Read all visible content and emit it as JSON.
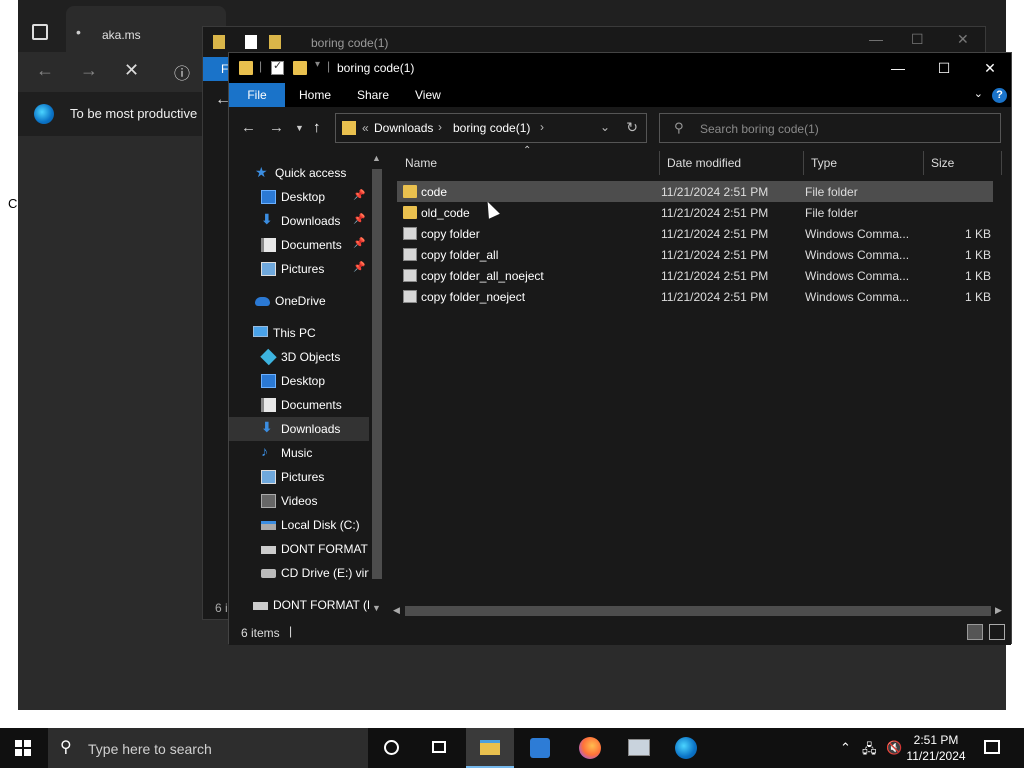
{
  "browser": {
    "tab_title": "aka.ms",
    "info_message": "To be most productive",
    "left_letter": "C"
  },
  "bg_window": {
    "title": "boring code(1)",
    "ribbon_letter": "F",
    "status": "6 i"
  },
  "window": {
    "title": "boring code(1)",
    "ribbon_tabs": [
      "File",
      "Home",
      "Share",
      "View"
    ],
    "address": {
      "overflow": "«",
      "segments": [
        "Downloads",
        "boring code(1)"
      ]
    },
    "search_placeholder": "Search boring code(1)",
    "nav_items": [
      {
        "label": "Quick access",
        "icon": "star-icon",
        "pinned": false
      },
      {
        "label": "Desktop",
        "icon": "desktop-icon",
        "pinned": true
      },
      {
        "label": "Downloads",
        "icon": "download-icon",
        "pinned": true
      },
      {
        "label": "Documents",
        "icon": "documents-icon",
        "pinned": true
      },
      {
        "label": "Pictures",
        "icon": "pictures-icon",
        "pinned": true
      },
      {
        "label": "OneDrive",
        "icon": "cloud-icon",
        "pinned": false
      },
      {
        "label": "This PC",
        "icon": "computer-icon",
        "pinned": false
      },
      {
        "label": "3D Objects",
        "icon": "3d-objects-icon",
        "pinned": false
      },
      {
        "label": "Desktop",
        "icon": "desktop-icon",
        "pinned": false
      },
      {
        "label": "Documents",
        "icon": "documents-icon",
        "pinned": false
      },
      {
        "label": "Downloads",
        "icon": "download-icon",
        "pinned": false,
        "selected": true
      },
      {
        "label": "Music",
        "icon": "music-icon",
        "pinned": false
      },
      {
        "label": "Pictures",
        "icon": "pictures-icon",
        "pinned": false
      },
      {
        "label": "Videos",
        "icon": "videos-icon",
        "pinned": false
      },
      {
        "label": "Local Disk (C:)",
        "icon": "local-disk-icon",
        "pinned": false
      },
      {
        "label": "DONT FORMAT (",
        "icon": "drive-icon",
        "pinned": false
      },
      {
        "label": "CD Drive (E:) virt",
        "icon": "cd-drive-icon",
        "pinned": false
      },
      {
        "label": "DONT FORMAT (D",
        "icon": "drive-icon",
        "pinned": false
      }
    ],
    "columns": [
      "Name",
      "Date modified",
      "Type",
      "Size"
    ],
    "files": [
      {
        "name": "code",
        "date": "11/21/2024 2:51 PM",
        "type": "File folder",
        "size": "",
        "kind": "folder"
      },
      {
        "name": "old_code",
        "date": "11/21/2024 2:51 PM",
        "type": "File folder",
        "size": "",
        "kind": "folder"
      },
      {
        "name": "copy folder",
        "date": "11/21/2024 2:51 PM",
        "type": "Windows Comma...",
        "size": "1 KB",
        "kind": "cmd"
      },
      {
        "name": "copy folder_all",
        "date": "11/21/2024 2:51 PM",
        "type": "Windows Comma...",
        "size": "1 KB",
        "kind": "cmd"
      },
      {
        "name": "copy folder_all_noeject",
        "date": "11/21/2024 2:51 PM",
        "type": "Windows Comma...",
        "size": "1 KB",
        "kind": "cmd"
      },
      {
        "name": "copy folder_noeject",
        "date": "11/21/2024 2:51 PM",
        "type": "Windows Comma...",
        "size": "1 KB",
        "kind": "cmd"
      }
    ],
    "status_count": "6 items",
    "status_cursor": "|"
  },
  "taskbar": {
    "search_placeholder": "Type here to search",
    "time": "2:51 PM",
    "date": "11/21/2024"
  },
  "colors": {
    "accent": "#1a73c9",
    "folder": "#e9c04e",
    "window_bg": "#191919"
  }
}
